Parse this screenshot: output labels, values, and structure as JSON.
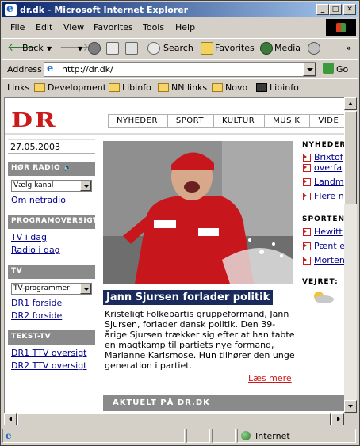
{
  "window": {
    "title": "dr.dk - Microsoft Internet Explorer",
    "minimize": "_",
    "maximize": "□",
    "close": "✕"
  },
  "menu": [
    "File",
    "Edit",
    "View",
    "Favorites",
    "Tools",
    "Help"
  ],
  "toolbar": {
    "back": "Back",
    "search": "Search",
    "favorites": "Favorites",
    "media": "Media"
  },
  "address": {
    "label": "Address",
    "url": "http://dr.dk/",
    "go": "Go"
  },
  "links": {
    "label": "Links",
    "items": [
      "Development",
      "Libinfo",
      "NN links",
      "Novo",
      "Libinfo"
    ]
  },
  "page": {
    "logo": "DR",
    "nav": [
      "NYHEDER",
      "SPORT",
      "KULTUR",
      "MUSIK",
      "VIDE"
    ],
    "date": "27.05.2003",
    "hor_radio": {
      "heading": "HØR RADIO",
      "select": "Vælg kanal",
      "link": "Om netradio"
    },
    "programoversigt": {
      "heading": "PROGRAMOVERSIGT",
      "links": [
        "TV i dag",
        "Radio i dag"
      ]
    },
    "tv": {
      "heading": "TV",
      "select": "TV-programmer",
      "links": [
        "DR1 forside",
        "DR2 forside"
      ]
    },
    "tekst_tv": {
      "heading": "TEKST-TV",
      "links": [
        "DR1 TTV oversigt",
        "DR2 TTV oversigt"
      ]
    },
    "article": {
      "headline": "Jann Sjursen forlader politik",
      "body": "Kristeligt Folkepartis gruppeformand, Jann Sjursen, forlader dansk politik. Den 39-årige Sjursen trækker sig efter at han tabte en magtkamp til partiets nye formand, Marianne Karlsmose. Hun tilhører den unge generation i partiet.",
      "read_more": "Læs mere"
    },
    "aktuelt": "AKTUELT PÅ DR.DK",
    "right": {
      "nyheder_heading": "NYHEDER",
      "nyheder_items": [
        "Brixtof",
        "overfa",
        "Landm",
        "Flere n"
      ],
      "sporten_heading": "SPORTEN",
      "sporten_items": [
        "Hewitt",
        "Pænt e",
        "Morten"
      ],
      "vejret_heading": "VEJRET:"
    }
  },
  "status": {
    "zone": "Internet"
  }
}
